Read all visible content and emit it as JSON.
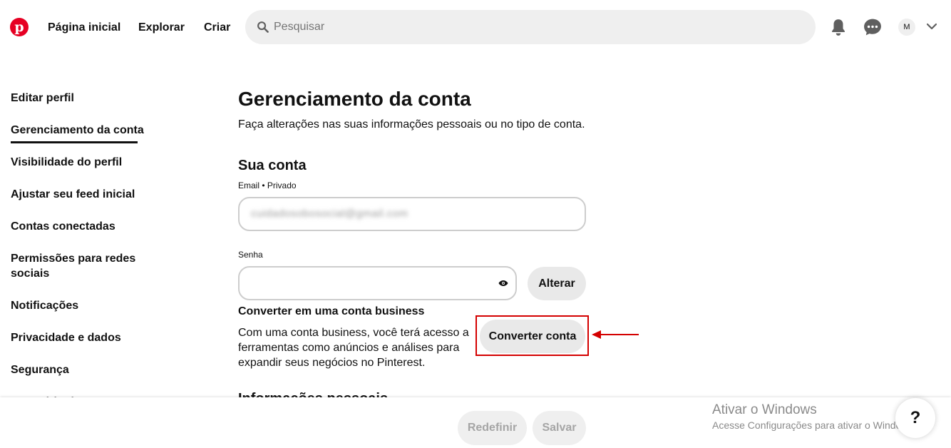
{
  "header": {
    "logo": "pinterest-logo",
    "nav": [
      {
        "label": "Página inicial"
      },
      {
        "label": "Explorar"
      },
      {
        "label": "Criar"
      }
    ],
    "search": {
      "placeholder": "Pesquisar"
    },
    "avatar_initial": "M",
    "accent_color": "#e60023"
  },
  "sidebar": {
    "items": [
      {
        "label": "Editar perfil"
      },
      {
        "label": "Gerenciamento da conta",
        "active": true
      },
      {
        "label": "Visibilidade do perfil"
      },
      {
        "label": "Ajustar seu feed inicial"
      },
      {
        "label": "Contas conectadas"
      },
      {
        "label": "Permissões para redes sociais"
      },
      {
        "label": "Notificações"
      },
      {
        "label": "Privacidade e dados"
      },
      {
        "label": "Segurança"
      },
      {
        "label": "Conteúdo da marca"
      }
    ]
  },
  "main": {
    "title": "Gerenciamento da conta",
    "subtitle": "Faça alterações nas suas informações pessoais ou no tipo de conta.",
    "account_section": {
      "title": "Sua conta",
      "email_label": "Email • Privado",
      "email_value": "cuidadosobosocial@gmail.com",
      "password_label": "Senha",
      "change_button": "Alterar"
    },
    "business": {
      "title": "Converter em uma conta business",
      "description": "Com uma conta business, você terá acesso a ferramentas como anúncios e análises para expandir seus negócios no Pinterest.",
      "convert_button": "Converter conta"
    },
    "personal_section_title": "Informações pessoais"
  },
  "footer": {
    "reset_button": "Redefinir",
    "save_button": "Salvar",
    "help_label": "?"
  },
  "windows_watermark": {
    "title": "Ativar o Windows",
    "subtitle": "Acesse Configurações para ativar o Windows."
  },
  "annotation_color": "#d40000"
}
